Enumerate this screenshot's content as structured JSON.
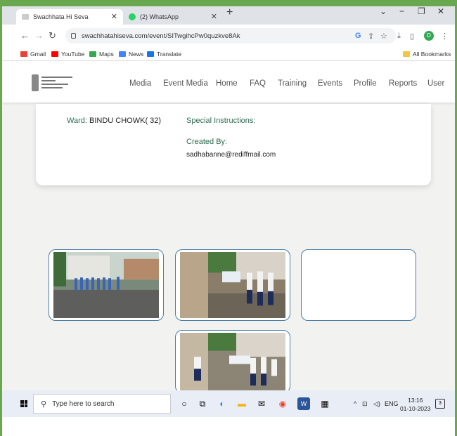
{
  "browser": {
    "tabs": [
      {
        "label": "Swachhata Hi Seva",
        "active": true
      },
      {
        "label": "(2) WhatsApp",
        "active": false
      }
    ],
    "url": "swachhatahiseva.com/event/SITwgihcPw0quzkve8Ak",
    "profile_initial": "D",
    "bookmarks": [
      "Gmail",
      "YouTube",
      "Maps",
      "News",
      "Translate"
    ],
    "all_bookmarks": "All Bookmarks"
  },
  "site": {
    "nav": [
      "Media",
      "Event Media",
      "Home",
      "FAQ",
      "Training",
      "Events",
      "Profile",
      "Reports",
      "User"
    ]
  },
  "event": {
    "ward_label": "Ward:",
    "ward_value": "BINDU CHOWK( 32)",
    "special_instructions_label": "Special Instructions:",
    "created_by_label": "Created By:",
    "created_by_value": "sadhabanne@rediffmail.com"
  },
  "taskbar": {
    "search_placeholder": "Type here to search",
    "language": "ENG",
    "time": "13:16",
    "date": "01-10-2023",
    "notification_count": "3"
  },
  "colors": {
    "accent_green": "#2d6a4f",
    "frame_green": "#6aa84f",
    "photo_border": "#4a7fa8"
  }
}
